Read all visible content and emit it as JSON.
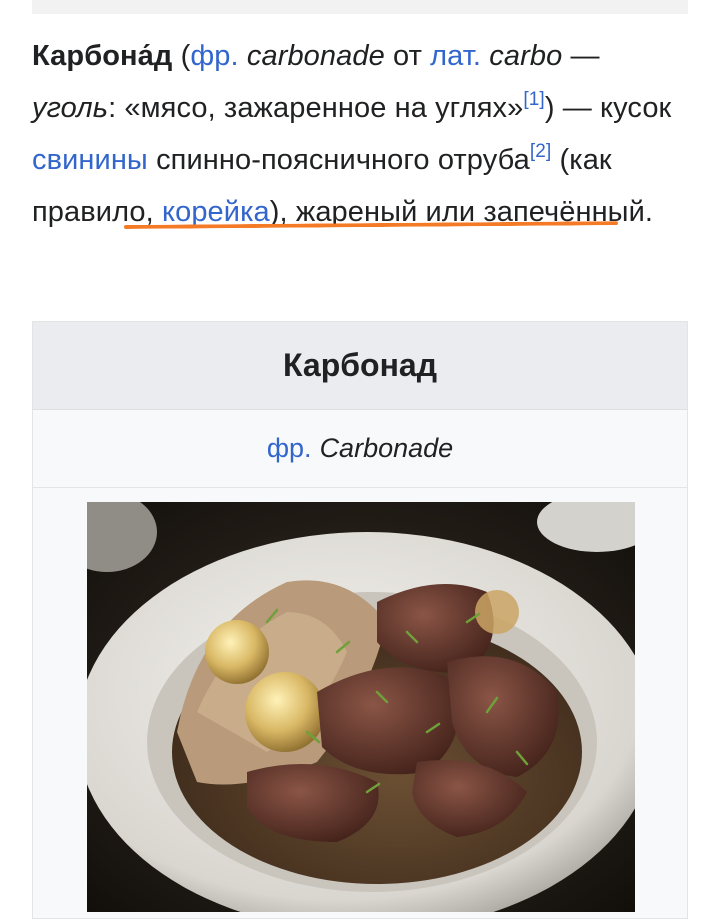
{
  "article": {
    "term": "Карбона́д",
    "paren_open": "(",
    "lang_fr": "фр.",
    "fr_word": "carbonade",
    "from_word": "от",
    "lang_lat": "лат.",
    "lat_word": "carbo",
    "dash1": "—",
    "lat_meaning": "уголь",
    "quote": ": «мясо, зажаренное на углях»",
    "ref1": "[1]",
    "paren_close_dash": ") —",
    "kusok": "кусок",
    "pork_link": "свинины",
    "desc1": "спинно-поясничного",
    "desc2": "отруба",
    "ref2": "[2]",
    "paren2_open": "(как правило,",
    "loin_link": "корейка",
    "desc3": "), жареный",
    "desc4": "или запечённый."
  },
  "infobox": {
    "title": "Карбонад",
    "lang_link": "фр.",
    "lang_word": "Carbonade"
  },
  "colors": {
    "link": "#3366cc",
    "highlight": "#f47a26",
    "infobox_header": "#eaecf0"
  }
}
